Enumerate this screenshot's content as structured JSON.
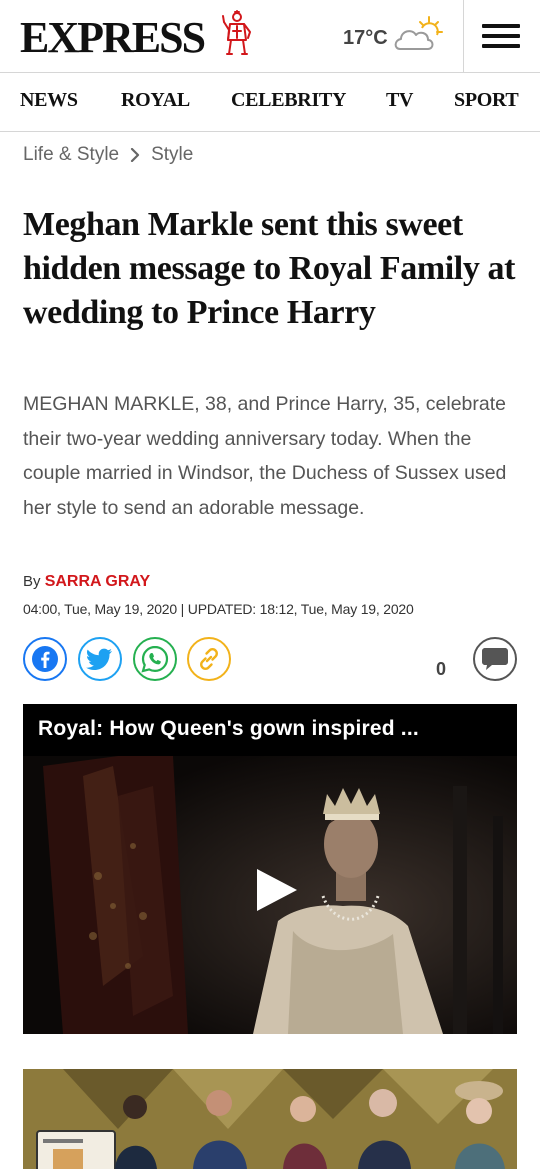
{
  "header": {
    "logo_text": "EXPRESS",
    "weather": {
      "temperature": "17°C",
      "icon": "partly-cloudy-icon"
    },
    "menu_icon": "hamburger-menu-icon"
  },
  "nav": {
    "items": [
      {
        "label": "NEWS"
      },
      {
        "label": "ROYAL"
      },
      {
        "label": "CELEBRITY"
      },
      {
        "label": "TV"
      },
      {
        "label": "SPORT"
      }
    ]
  },
  "breadcrumb": {
    "section": "Life & Style",
    "subsection": "Style"
  },
  "article": {
    "headline": "Meghan Markle sent this sweet hidden message to Royal Family at wedding to Prince Harry",
    "standfirst": "MEGHAN MARKLE, 38, and Prince Harry, 35, celebrate their two-year wedding anniversary today. When the couple married in Windsor, the Duchess of Sussex used her style to send an adorable message.",
    "byline_prefix": "By",
    "author": "SARRA GRAY",
    "dates": "04:00, Tue, May 19, 2020 | UPDATED: 18:12, Tue, May 19, 2020"
  },
  "share": {
    "buttons": [
      {
        "name": "facebook-icon",
        "color": "#1877f2"
      },
      {
        "name": "twitter-icon",
        "color": "#1da1f2"
      },
      {
        "name": "whatsapp-icon",
        "color": "#25b050"
      },
      {
        "name": "link-icon",
        "color": "#f2b21a"
      }
    ],
    "comment_count": "0"
  },
  "video": {
    "title": "Royal: How Queen's gown inspired ..."
  },
  "colors": {
    "accent_red": "#d2171b",
    "promo_gold": "#8d7a3c"
  }
}
